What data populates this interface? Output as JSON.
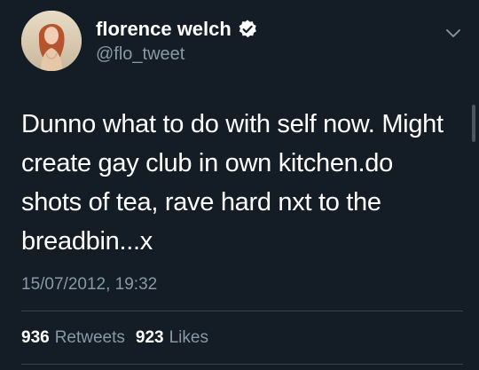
{
  "user": {
    "display_name": "florence welch",
    "handle": "@flo_tweet",
    "verified": true,
    "avatar_icon": "profile-photo"
  },
  "tweet": {
    "lines": [
      "Dunno what to do with self now. Might",
      "create gay club in own kitchen.do",
      "shots of tea, rave hard nxt to the",
      "breadbin...x"
    ],
    "timestamp": "15/07/2012, 19:32"
  },
  "stats": {
    "retweets_count": "936",
    "retweets_label": "Retweets",
    "likes_count": "923",
    "likes_label": "Likes"
  },
  "icons": {
    "verified": "verified-badge-icon",
    "menu": "chevron-down-icon"
  },
  "colors": {
    "background": "#141d26",
    "text_primary": "#ffffff",
    "text_secondary": "#8899a6",
    "divider": "#38444d",
    "verified_badge": "#ffffff"
  }
}
